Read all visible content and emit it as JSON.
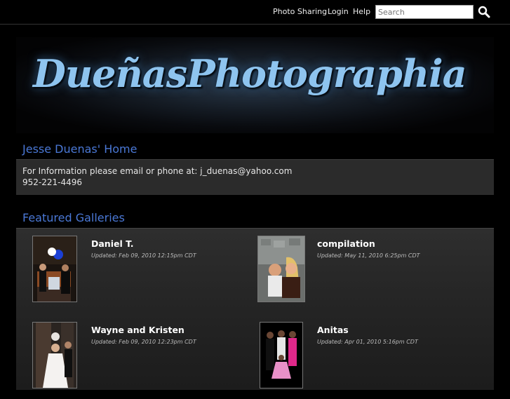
{
  "nav": {
    "photo_sharing": "Photo Sharing",
    "login": "Login",
    "help": "Help",
    "search_placeholder": "Search"
  },
  "banner": {
    "title": "DueñasPhotographia"
  },
  "home": {
    "title": "Jesse Duenas' Home",
    "info_line1": "For Information please email or phone at: j_duenas@yahoo.com",
    "info_line2": "952-221-4496"
  },
  "featured": {
    "title": "Featured Galleries",
    "galleries": [
      {
        "name": "Daniel T.",
        "updated": "Updated: Feb 09, 2010 12:15pm CDT"
      },
      {
        "name": "compilation",
        "updated": "Updated: May 11, 2010 6:25pm CDT"
      },
      {
        "name": "Wayne and Kristen",
        "updated": "Updated: Feb 09, 2010 12:23pm CDT"
      },
      {
        "name": "Anitas",
        "updated": "Updated: Apr 01, 2010 5:16pm CDT"
      }
    ]
  },
  "colors": {
    "accent": "#4a78d6",
    "banner_text": "#8ec4ef"
  }
}
